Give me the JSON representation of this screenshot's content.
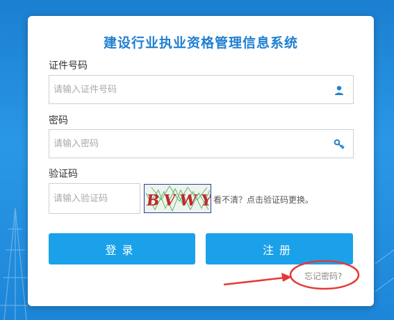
{
  "login": {
    "title": "建设行业执业资格管理信息系统",
    "id_label": "证件号码",
    "id_placeholder": "请输入证件号码",
    "password_label": "密码",
    "password_placeholder": "请输入密码",
    "captcha_label": "验证码",
    "captcha_placeholder": "请输入验证码",
    "captcha_text": "BVWY",
    "captcha_hint": "看不清？点击验证码更换。",
    "login_button": "登录",
    "register_button": "注册",
    "forgot_password": "忘记密码?"
  },
  "icons": {
    "id_field_icon": "user-icon",
    "password_field_icon": "key-icon"
  },
  "colors": {
    "accent": "#1aa1ea",
    "title": "#1f7fd1",
    "annotation": "#e53935",
    "background": "#2a97e6"
  }
}
